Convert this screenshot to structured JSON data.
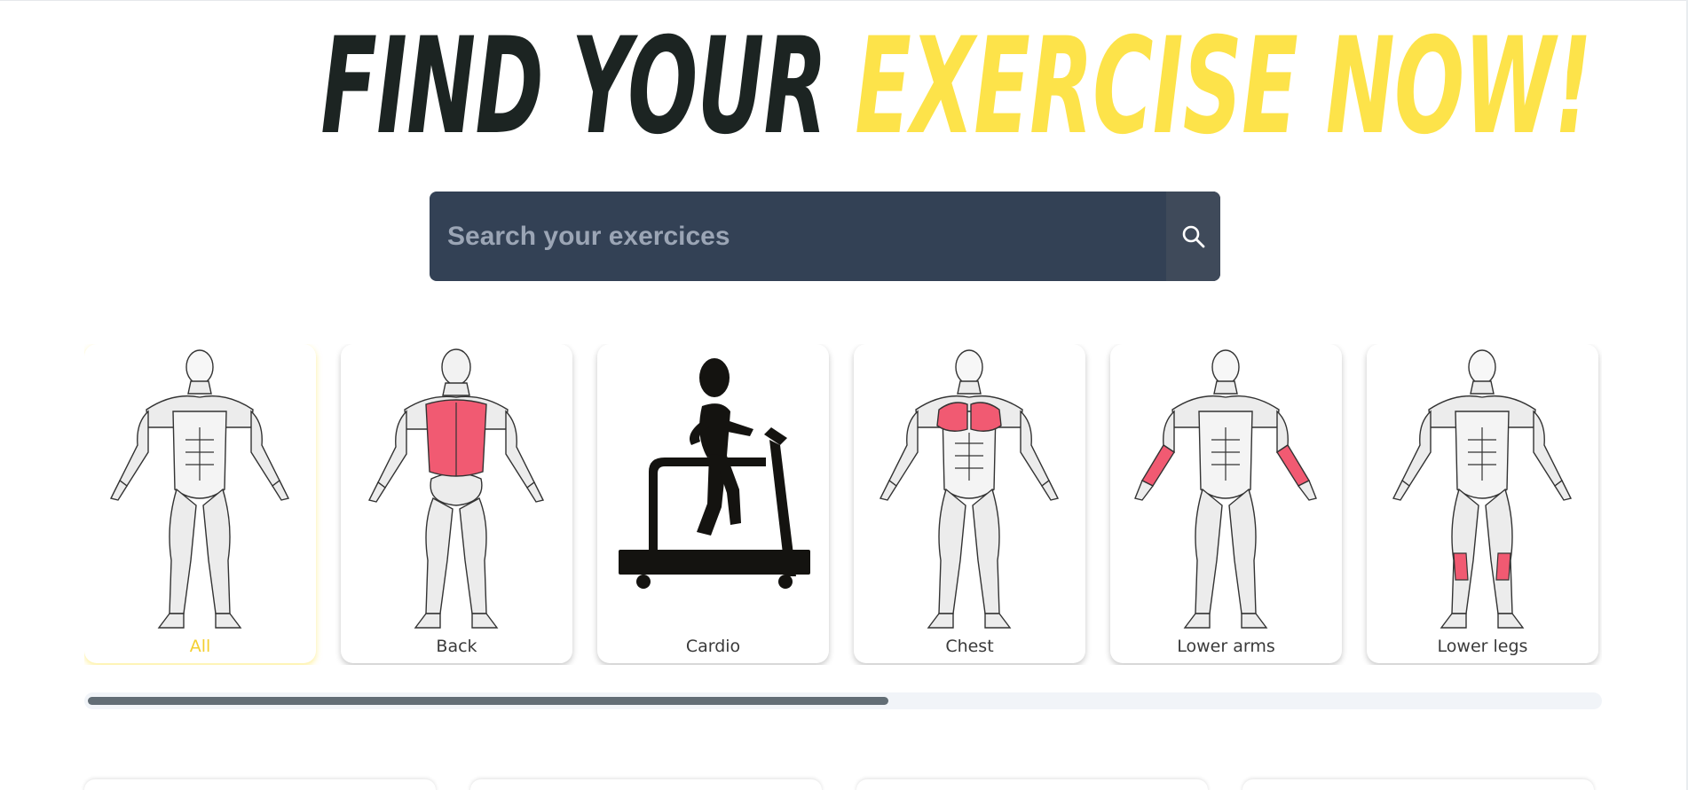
{
  "header": {
    "title_part1": "FIND YOUR",
    "title_part2": "EXERCISE NOW!",
    "title_dark_color": "#1c2422",
    "title_accent_color": "#fde34a"
  },
  "search": {
    "placeholder": "Search your exercices",
    "value": "",
    "background": "#334155",
    "button_icon": "search-icon"
  },
  "categories": [
    {
      "label": "All",
      "icon": "full-body-icon",
      "active": true
    },
    {
      "label": "Back",
      "icon": "back-muscles-icon",
      "active": false
    },
    {
      "label": "Cardio",
      "icon": "treadmill-runner-icon",
      "active": false
    },
    {
      "label": "Chest",
      "icon": "chest-muscles-icon",
      "active": false
    },
    {
      "label": "Lower arms",
      "icon": "forearm-muscles-icon",
      "active": false
    },
    {
      "label": "Lower legs",
      "icon": "calf-muscles-icon",
      "active": false
    }
  ],
  "colors": {
    "highlight_muscle": "#f15a72",
    "active_label": "#f4cf2f"
  },
  "carousel_scroll": {
    "fraction_visible": 0.53
  }
}
